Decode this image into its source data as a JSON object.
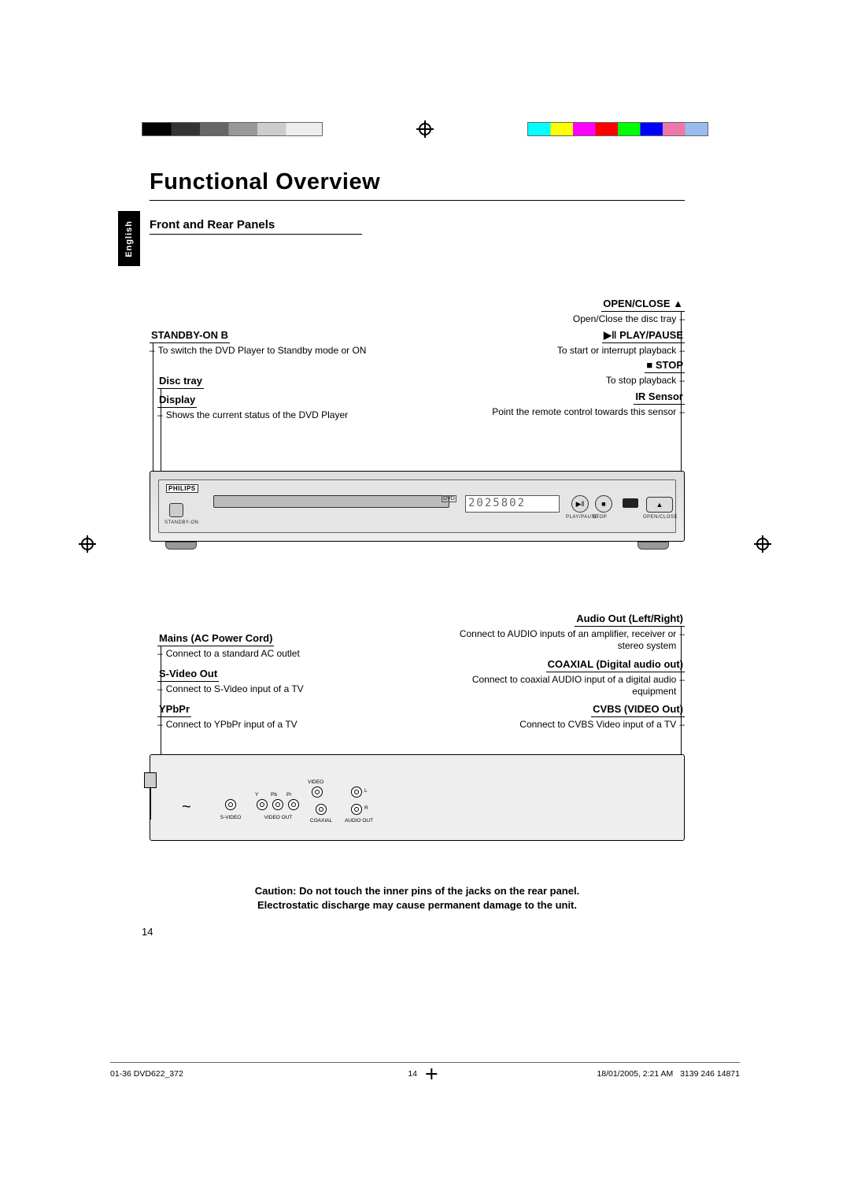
{
  "lang_tab": "English",
  "title": "Functional Overview",
  "subsection": "Front and Rear Panels",
  "front": {
    "standby": {
      "label": "STANDBY-ON",
      "symbol": "B",
      "desc": "To switch the DVD Player to Standby mode or ON"
    },
    "disc_tray": {
      "label": "Disc tray"
    },
    "display": {
      "label": "Display",
      "desc": "Shows the current status of the DVD Player"
    },
    "open_close": {
      "label": "OPEN/CLOSE",
      "symbol": "▲",
      "desc": "Open/Close the disc tray"
    },
    "play_pause": {
      "label": "PLAY/PAUSE",
      "symbol": "▶ǁ",
      "desc": "To start or interrupt playback"
    },
    "stop": {
      "label": "STOP",
      "symbol": "■",
      "desc": "To stop playback"
    },
    "ir": {
      "label": "IR Sensor",
      "desc": "Point the remote control towards this sensor"
    },
    "panel": {
      "brand": "PHILIPS",
      "display_readout": "2025802",
      "dvd_logo": "DVD",
      "btn_play": "▶ǁ",
      "btn_stop": "■",
      "btn_oc": "▲",
      "sub_standby": "STANDBY-ON",
      "sub_stop": "STOP",
      "sub_play": "PLAY/PAUSE",
      "sub_oc": "OPEN/CLOSE"
    }
  },
  "rear": {
    "mains": {
      "label": "Mains (AC Power Cord)",
      "desc": "Connect to a standard AC outlet"
    },
    "svideo": {
      "label": "S-Video Out",
      "desc": "Connect to S-Video input of a TV"
    },
    "ypbpr": {
      "label": "YPbPr",
      "desc": "Connect to YPbPr input of a TV"
    },
    "audio": {
      "label": "Audio Out (Left/Right)",
      "desc": "Connect to AUDIO inputs of an amplifier, receiver or stereo system"
    },
    "coax": {
      "label": "COAXIAL (Digital audio out)",
      "desc": "Connect to coaxial AUDIO input of a digital audio equipment"
    },
    "cvbs": {
      "label": "CVBS (VIDEO Out)",
      "desc": "Connect to CVBS Video input of a TV"
    },
    "panel": {
      "tilde": "~",
      "lbl_svideo": "S-VIDEO",
      "lbl_videoout": "VIDEO OUT",
      "lbl_coax": "COAXIAL",
      "lbl_audioout": "AUDIO OUT",
      "lbl_y": "Y",
      "lbl_pb": "Pb",
      "lbl_pr": "Pr",
      "lbl_video": "VIDEO",
      "lbl_l": "L",
      "lbl_r": "R"
    }
  },
  "caution_line1": "Caution: Do not touch the inner pins of the jacks on the rear panel.",
  "caution_line2": "Electrostatic discharge may cause permanent damage to the unit.",
  "page_number_main": "14",
  "footer": {
    "left": "01-36 DVD622_372",
    "mid_num": "14",
    "right_date": "18/01/2005, 2:21 AM",
    "right_code": "3139 246 14871"
  }
}
